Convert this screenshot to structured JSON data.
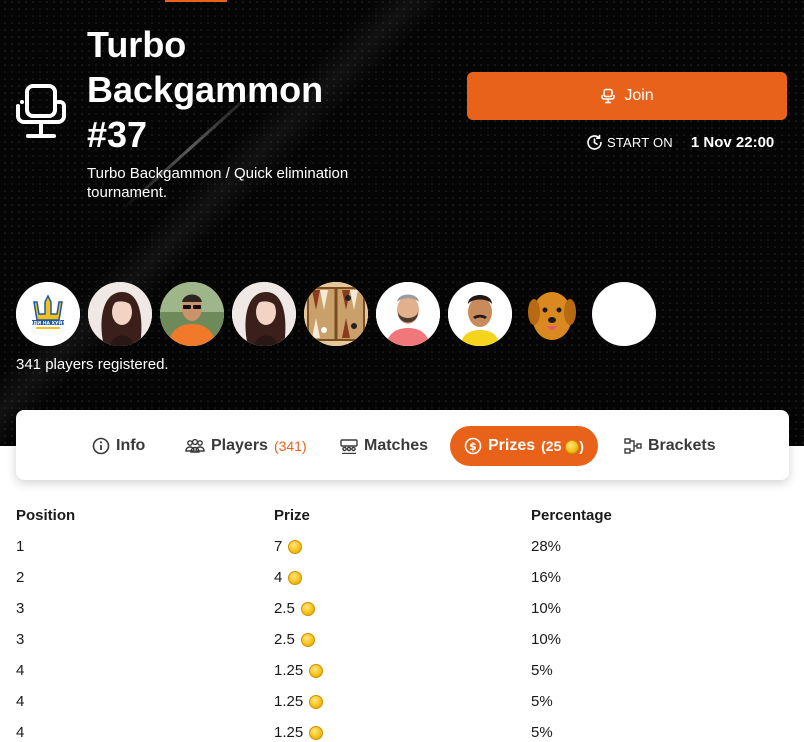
{
  "tournament": {
    "title": "Turbo Backgammon #37",
    "subtitle": "Turbo Backgammon / Quick elimination tournament.",
    "join_label": "Join",
    "start_label": "START ON",
    "start_value": "1 Nov 22:00",
    "players_registered": "341 players registered."
  },
  "avatars": [
    {
      "name": "avatar-flag",
      "caption": "ІДИ НА ХУЙ!"
    },
    {
      "name": "avatar-woman-1"
    },
    {
      "name": "avatar-man-sunglasses"
    },
    {
      "name": "avatar-woman-2"
    },
    {
      "name": "avatar-backgammon-board"
    },
    {
      "name": "avatar-man-beard"
    },
    {
      "name": "avatar-man-mustache"
    },
    {
      "name": "avatar-dog"
    },
    {
      "name": "avatar-blank"
    }
  ],
  "tabs": [
    {
      "label": "Info",
      "icon": "info-icon"
    },
    {
      "label": "Players",
      "count": "(341)",
      "icon": "players-icon"
    },
    {
      "label": "Matches",
      "icon": "matches-icon"
    },
    {
      "label": "Prizes",
      "count": "(25",
      "count_end": ")",
      "icon": "dollar-icon",
      "active": true
    },
    {
      "label": "Brackets",
      "icon": "brackets-icon"
    }
  ],
  "prizes": {
    "headers": [
      "Position",
      "Prize",
      "Percentage"
    ],
    "rows": [
      {
        "position": "1",
        "prize": "7",
        "percentage": "28%"
      },
      {
        "position": "2",
        "prize": "4",
        "percentage": "16%"
      },
      {
        "position": "3",
        "prize": "2.5",
        "percentage": "10%"
      },
      {
        "position": "3",
        "prize": "2.5",
        "percentage": "10%"
      },
      {
        "position": "4",
        "prize": "1.25",
        "percentage": "5%"
      },
      {
        "position": "4",
        "prize": "1.25",
        "percentage": "5%"
      },
      {
        "position": "4",
        "prize": "1.25",
        "percentage": "5%"
      }
    ]
  },
  "colors": {
    "accent": "#e8621a",
    "hero_bg": "#050506",
    "coin": "#f4c21b"
  }
}
